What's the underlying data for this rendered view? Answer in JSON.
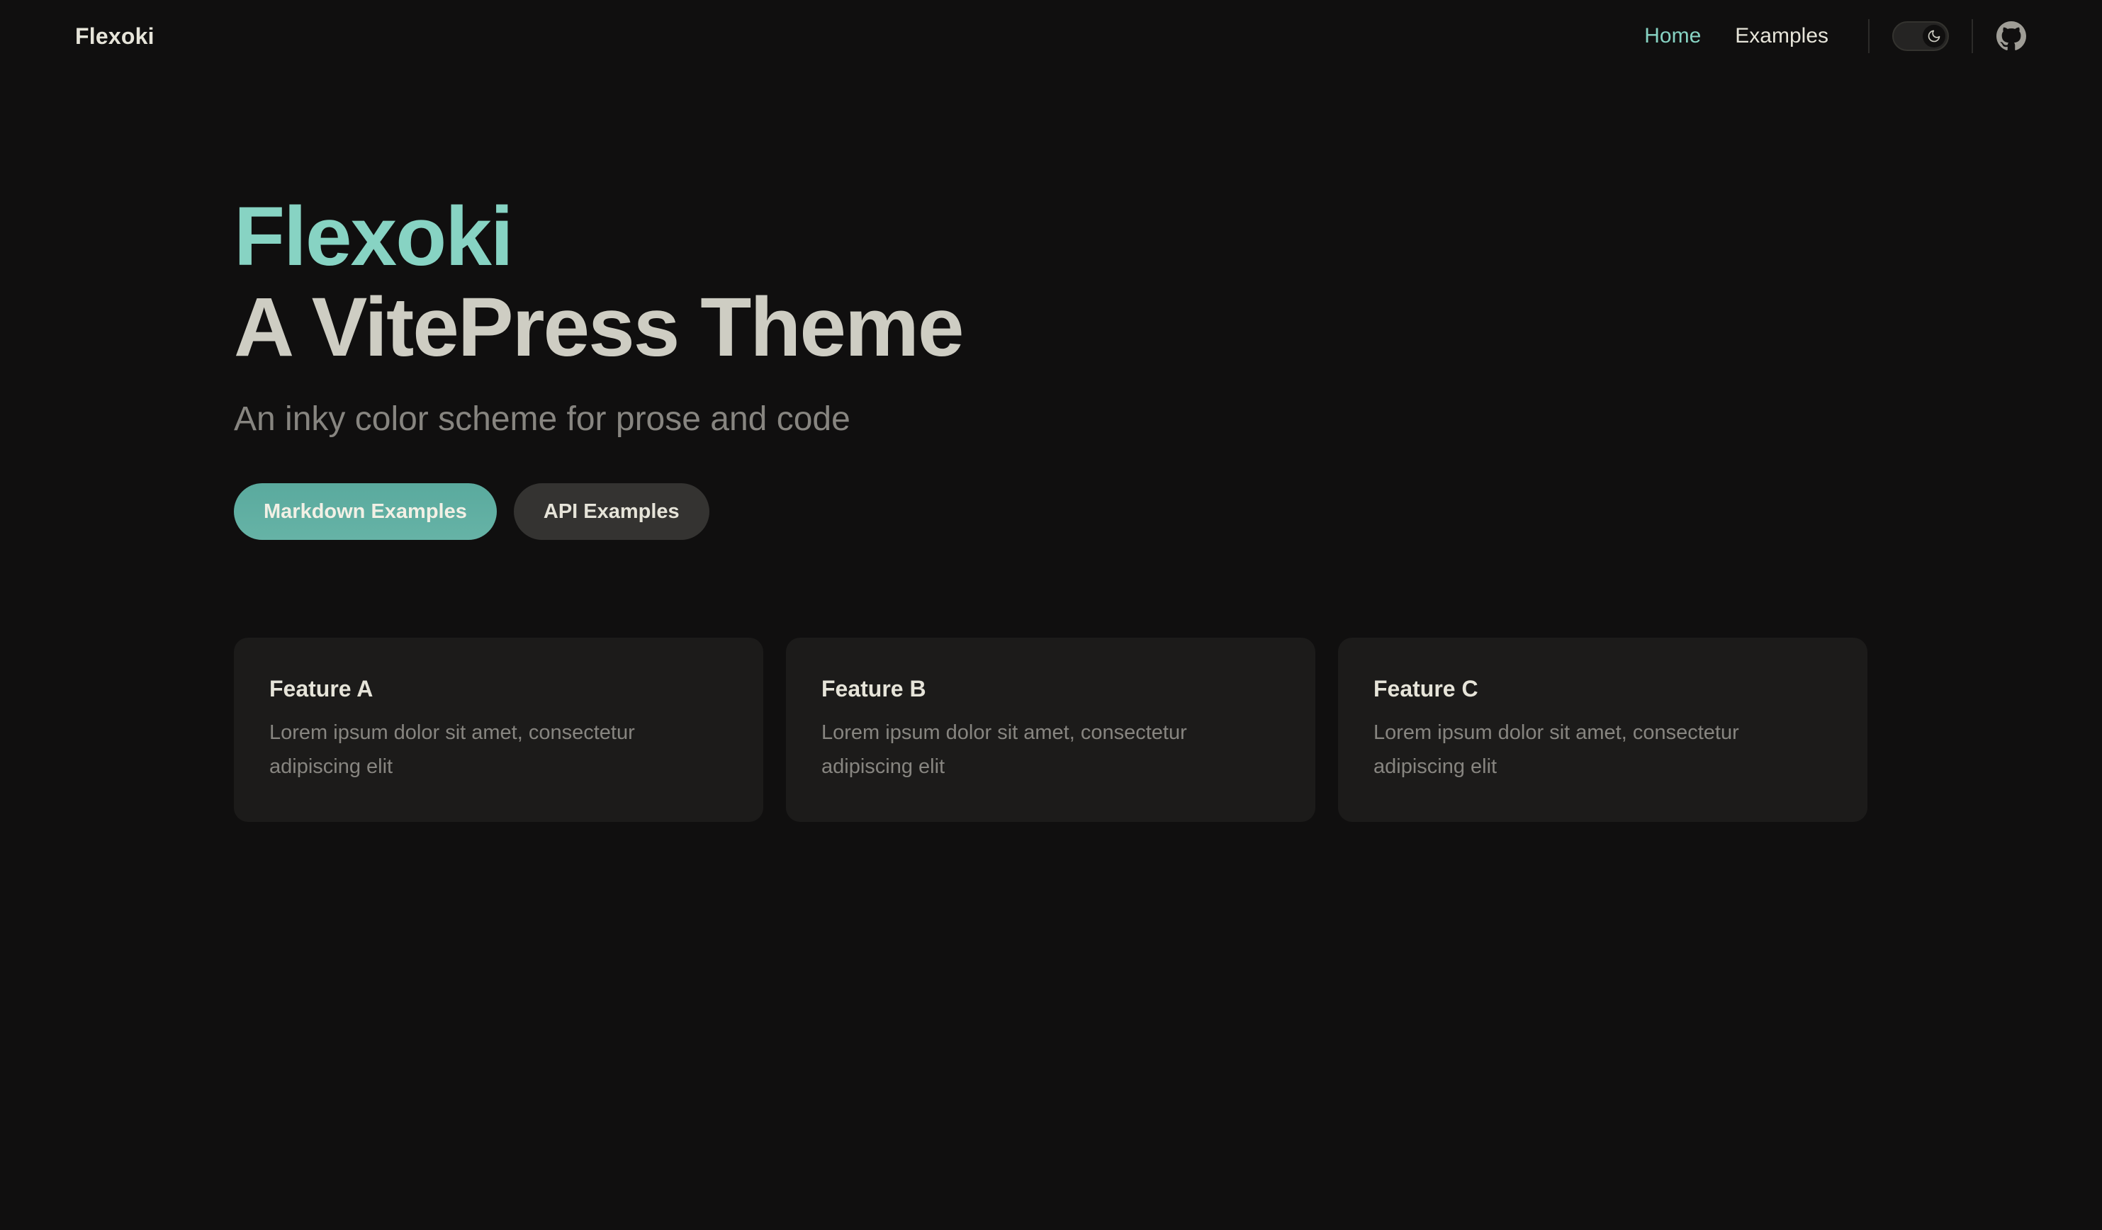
{
  "nav": {
    "brand": "Flexoki",
    "links": [
      {
        "label": "Home",
        "active": true
      },
      {
        "label": "Examples",
        "active": false
      }
    ],
    "appearance_toggle_icon": "moon-icon",
    "social_icon": "github-icon"
  },
  "hero": {
    "name": "Flexoki",
    "text": "A VitePress Theme",
    "tagline": "An inky color scheme for prose and code",
    "actions": [
      {
        "label": "Markdown Examples",
        "theme": "brand"
      },
      {
        "label": "API Examples",
        "theme": "alt"
      }
    ]
  },
  "features": [
    {
      "title": "Feature A",
      "details": "Lorem ipsum dolor sit amet, consectetur adipiscing elit"
    },
    {
      "title": "Feature B",
      "details": "Lorem ipsum dolor sit amet, consectetur adipiscing elit"
    },
    {
      "title": "Feature C",
      "details": "Lorem ipsum dolor sit amet, consectetur adipiscing elit"
    }
  ],
  "colors": {
    "background": "#100f0f",
    "brand": "#87d3c3",
    "card": "#1c1b1a",
    "text": "#cecdc3",
    "muted": "#878580"
  }
}
